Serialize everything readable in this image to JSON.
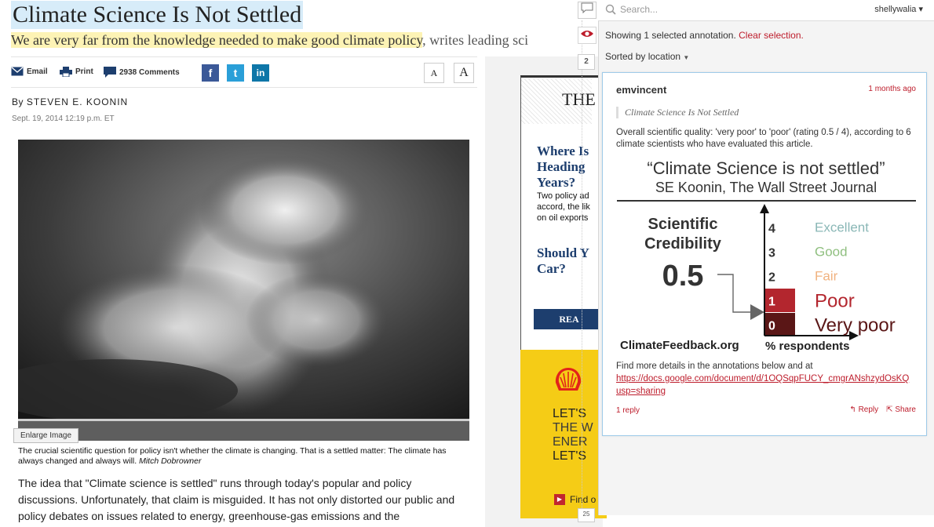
{
  "article": {
    "headline": "Climate Science Is Not Settled",
    "dek_highlighted": "We are very far from the knowledge needed to make good climate policy",
    "dek_rest": ", writes leading sci",
    "tools": {
      "email": "Email",
      "print": "Print",
      "comments": "2938 Comments"
    },
    "social": {
      "facebook": "f",
      "twitter": "t",
      "linkedin": "in"
    },
    "font_small": "A",
    "font_large": "A",
    "byline_prefix": "By",
    "author": "STEVEN E. KOONIN",
    "date": "Sept. 19, 2014 12:19 p.m. ET",
    "enlarge": "Enlarge Image",
    "caption": "The crucial scientific question for policy isn't whether the climate is changing. That is a settled matter: The climate has always changed and always will.",
    "caption_credit": "Mitch Dobrowner",
    "body": "The idea that \"Climate science is settled\" runs through today's popular and policy discussions. Unfortunately, that claim is misguided. It has not only distorted our public and policy debates on issues related to energy, greenhouse-gas emissions and the"
  },
  "ads": {
    "wsj_masthead": "THE",
    "promo1_headline": "Where Is Heading Years?",
    "promo1_text": "Two policy ad accord, the lik on oil exports",
    "promo2_headline": "Should Y Car?",
    "read_button": "REA",
    "shell_line1": "LET'S",
    "shell_line2": "THE W",
    "shell_line3": "ENER",
    "shell_line4": "LET'S",
    "shell_cta": "Find o"
  },
  "gutter": {
    "count_top": "2",
    "count_bottom": "25"
  },
  "sidebar": {
    "search_placeholder": "Search...",
    "username": "shellywalia ▾",
    "showing_text": "Showing 1 selected annotation.",
    "clear_selection": "Clear selection.",
    "sorted_by": "Sorted by location",
    "annotation": {
      "user": "emvincent",
      "time": "1 months ago",
      "quote": "Climate Science Is Not Settled",
      "text": "Overall scientific quality: 'very poor' to 'poor' (rating 0.5 / 4), according to 6 climate scientists who have evaluated this article.",
      "card_title": "“Climate Science is not settled”",
      "card_subtitle": "SE Koonin, The Wall Street Journal",
      "score_label_line1": "Scientific",
      "score_label_line2": "Credibility",
      "score": "0.5",
      "source_site": "ClimateFeedback.org",
      "axis_label": "% respondents",
      "find_more": "Find more details in the annotations below and at",
      "link": "https://docs.google.com/document/d/1OQSqpFUCY_cmgrANshzydOsKQ",
      "link_tail": "usp=sharing",
      "replies": "1 reply",
      "reply_button": "Reply",
      "share_button": "Share"
    }
  },
  "chart_data": {
    "type": "bar",
    "categories": [
      "0",
      "1",
      "2",
      "3",
      "4"
    ],
    "ratings": [
      "Very poor",
      "Poor",
      "Fair",
      "Good",
      "Excellent"
    ],
    "rating_colors": [
      "#5a1616",
      "#b3262e",
      "#f0b27f",
      "#8fbf7f",
      "#8ab7b6"
    ],
    "values": [
      1,
      1,
      0,
      0,
      0
    ],
    "xlabel": "% respondents",
    "title": "Scientific Credibility",
    "score": 0.5
  }
}
